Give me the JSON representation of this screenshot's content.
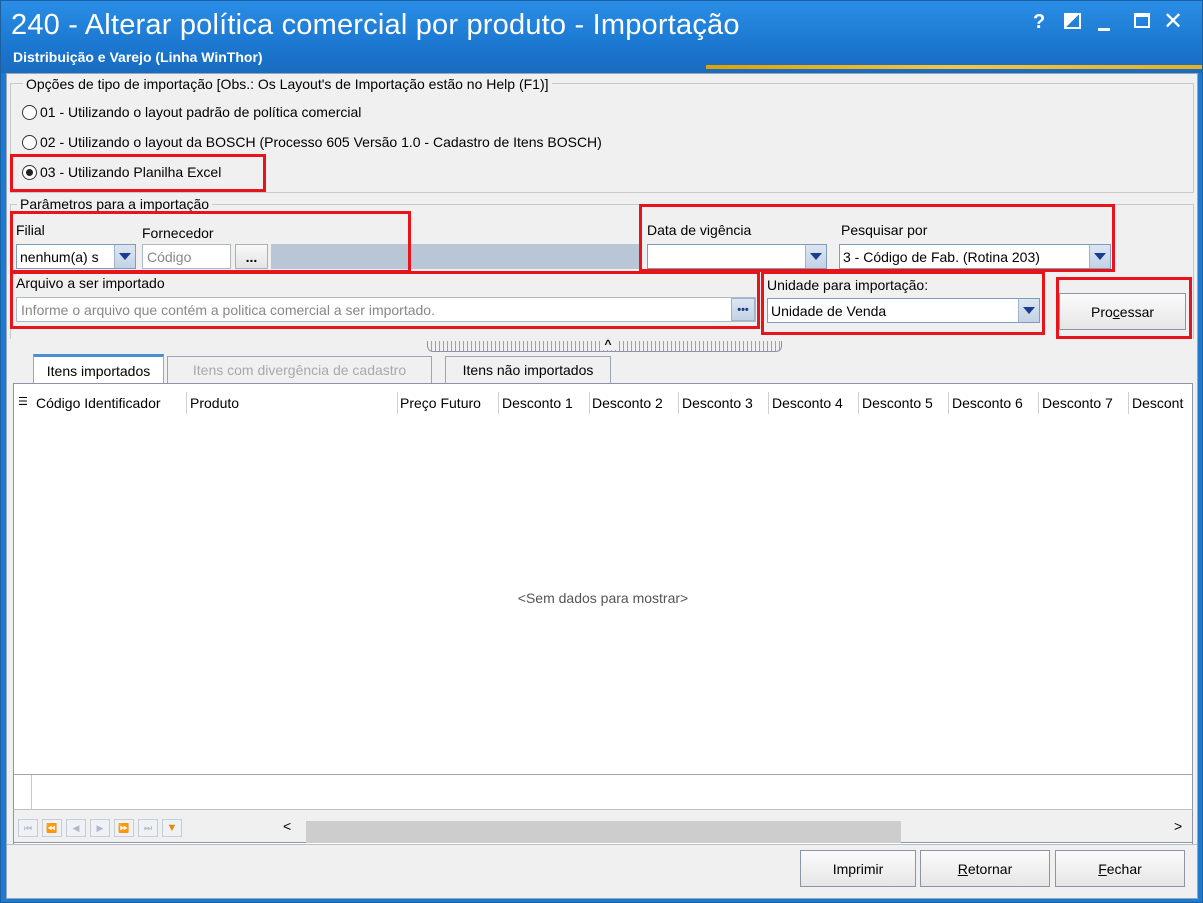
{
  "window": {
    "title": "240 - Alterar política comercial por produto - Importação",
    "subtitle": "Distribuição e Varejo (Linha WinThor)",
    "help_glyph": "?",
    "close_glyph": "✕"
  },
  "import_type": {
    "group_title": "Opções de tipo de importação  [Obs.: Os Layout's de Importação estão no Help (F1)]",
    "options": [
      {
        "label": "01 - Utilizando o layout padrão de política comercial",
        "selected": false
      },
      {
        "label": "02 - Utilizando o layout da BOSCH (Processo 605 Versão 1.0 - Cadastro de Itens BOSCH)",
        "selected": false
      },
      {
        "label": "03 - Utilizando Planilha Excel",
        "selected": true
      }
    ]
  },
  "params": {
    "group_title": "Parâmetros para a importação",
    "filial_label": "Filial",
    "filial_value": "nenhum(a) s",
    "fornecedor_label": "Fornecedor",
    "fornecedor_placeholder": "Código",
    "fornecedor_search_glyph": "...",
    "data_vigencia_label": "Data de vigência",
    "data_vigencia_value": "",
    "pesquisar_label": "Pesquisar por",
    "pesquisar_value": "3 - Código de Fab. (Rotina 203)",
    "arquivo_label": "Arquivo a ser importado",
    "arquivo_placeholder": "Informe o arquivo que contém a politica comercial a ser importado.",
    "arquivo_btn_glyph": "•••",
    "unidade_label": "Unidade para importação:",
    "unidade_value": "Unidade de Venda",
    "processar_pre": "Pro",
    "processar_u": "c",
    "processar_post": "essar"
  },
  "tabs": [
    {
      "label": "Itens importados",
      "state": "active"
    },
    {
      "label": "Itens com divergência de cadastro",
      "state": "disabled"
    },
    {
      "label": "Itens não importados",
      "state": "normal"
    }
  ],
  "grid": {
    "columns": [
      "Código Identificador",
      "Produto",
      "Preço Futuro",
      "Desconto 1",
      "Desconto 2",
      "Desconto 3",
      "Desconto 4",
      "Desconto 5",
      "Desconto 6",
      "Desconto 7",
      "Descont"
    ],
    "empty_text": "<Sem dados para mostrar>",
    "scroll_left_glyph": "<",
    "scroll_right_glyph": ">"
  },
  "footer": {
    "imprimir": "Imprimir",
    "retornar_u": "R",
    "retornar_rest": "etornar",
    "fechar_u": "F",
    "fechar_rest": "echar"
  }
}
